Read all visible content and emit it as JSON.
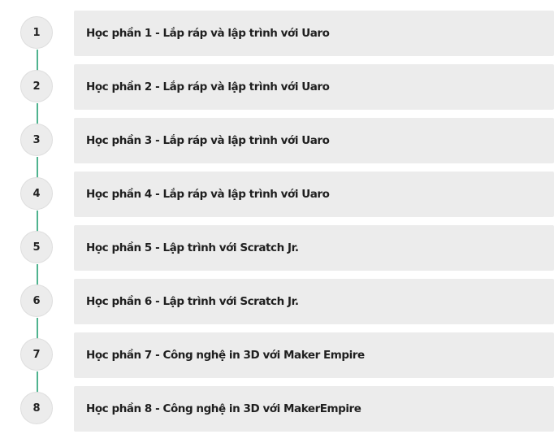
{
  "accent_color": "#4fb38f",
  "modules": [
    {
      "number": "1",
      "title": "Học phần 1 - Lắp ráp và lập trình với Uaro"
    },
    {
      "number": "2",
      "title": "Học phần 2 - Lắp ráp và lập trình với Uaro"
    },
    {
      "number": "3",
      "title": "Học phần 3 - Lắp ráp và lập trình với Uaro"
    },
    {
      "number": "4",
      "title": "Học phần 4 - Lắp ráp và lập trình với Uaro"
    },
    {
      "number": "5",
      "title": "Học phần 5 - Lập trình với Scratch Jr."
    },
    {
      "number": "6",
      "title": "Học phần 6 - Lập trình với Scratch Jr."
    },
    {
      "number": "7",
      "title": "Học phần 7 - Công nghệ in 3D với Maker Empire"
    },
    {
      "number": "8",
      "title": "Học phần 8 - Công nghệ in 3D với MakerEmpire"
    }
  ]
}
